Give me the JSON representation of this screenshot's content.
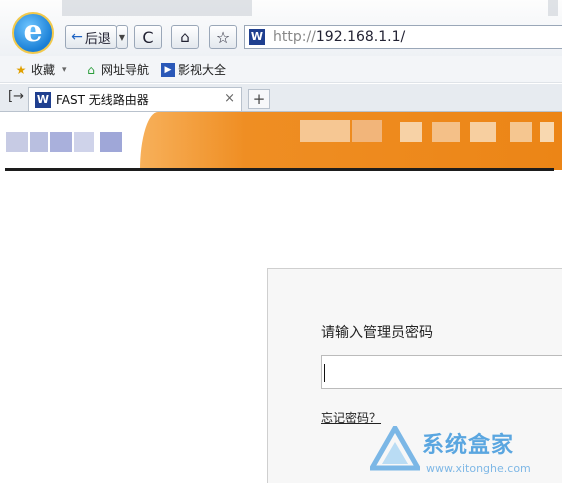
{
  "browser": {
    "back_label": "后退",
    "back_arrow": "←",
    "dropdown_glyph": "▼",
    "refresh_glyph": "C",
    "home_glyph": "⌂",
    "favorite_glyph": "☆",
    "site_icon_letter": "W",
    "url_protocol": "http://",
    "url_host": "192.168.1.1/",
    "logo_letter": "e"
  },
  "favorites_bar": {
    "items": [
      {
        "label": "收藏",
        "icon": "star-icon",
        "glyph": "★"
      },
      {
        "label": "网址导航",
        "icon": "home-nav-icon",
        "glyph": "⌂"
      },
      {
        "label": "影视大全",
        "icon": "film-icon",
        "glyph": "▶"
      }
    ],
    "dropdown_glyph": "▾"
  },
  "tabs": {
    "toggle_glyph": "[→",
    "active": {
      "title": "FAST 无线路由器",
      "icon_letter": "W",
      "close_glyph": "×"
    },
    "new_tab_glyph": "+"
  },
  "login": {
    "prompt": "请输入管理员密码",
    "password_value": "",
    "forgot_link": "忘记密码？"
  },
  "watermark": {
    "brand": "系统盒家",
    "url": "www.xitonghe.com"
  },
  "colors": {
    "banner_orange": "#ec8516",
    "link_blue": "#1e63c4",
    "watermark_blue": "#5aa6e0"
  }
}
